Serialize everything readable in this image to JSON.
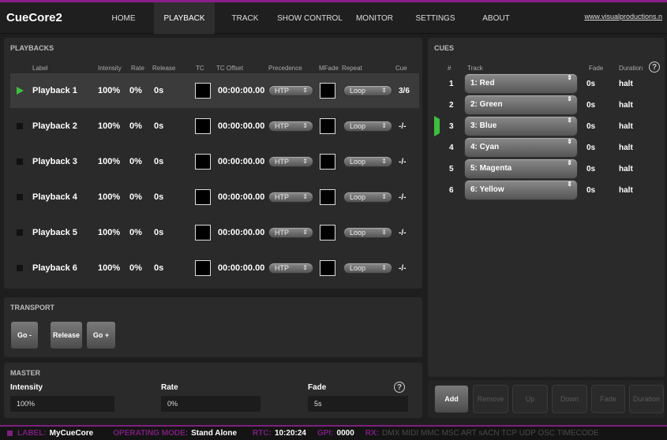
{
  "app": {
    "title": "CueCore2",
    "link": "www.visualproductions.n"
  },
  "nav": {
    "tabs": [
      {
        "label": "HOME"
      },
      {
        "label": "PLAYBACK"
      },
      {
        "label": "TRACK"
      },
      {
        "label": "SHOW CONTROL"
      },
      {
        "label": "MONITOR"
      },
      {
        "label": "SETTINGS"
      },
      {
        "label": "ABOUT"
      }
    ],
    "active": "PLAYBACK"
  },
  "playbacks": {
    "title": "PLAYBACKS",
    "headers": {
      "label": "Label",
      "intensity": "Intensity",
      "rate": "Rate",
      "release": "Release",
      "tc": "TC",
      "tc_offset": "TC Offset",
      "precedence": "Precedence",
      "mfade": "MFade",
      "repeat": "Repeat",
      "cue": "Cue"
    },
    "rows": [
      {
        "label": "Playback 1",
        "intensity": "100%",
        "rate": "0%",
        "release": "0s",
        "tc_offset": "00:00:00.00",
        "precedence": "HTP",
        "repeat": "Loop",
        "cue": "3/6",
        "active": true
      },
      {
        "label": "Playback 2",
        "intensity": "100%",
        "rate": "0%",
        "release": "0s",
        "tc_offset": "00:00:00.00",
        "precedence": "HTP",
        "repeat": "Loop",
        "cue": "-/-",
        "active": false
      },
      {
        "label": "Playback 3",
        "intensity": "100%",
        "rate": "0%",
        "release": "0s",
        "tc_offset": "00:00:00.00",
        "precedence": "HTP",
        "repeat": "Loop",
        "cue": "-/-",
        "active": false
      },
      {
        "label": "Playback 4",
        "intensity": "100%",
        "rate": "0%",
        "release": "0s",
        "tc_offset": "00:00:00.00",
        "precedence": "HTP",
        "repeat": "Loop",
        "cue": "-/-",
        "active": false
      },
      {
        "label": "Playback 5",
        "intensity": "100%",
        "rate": "0%",
        "release": "0s",
        "tc_offset": "00:00:00.00",
        "precedence": "HTP",
        "repeat": "Loop",
        "cue": "-/-",
        "active": false
      },
      {
        "label": "Playback 6",
        "intensity": "100%",
        "rate": "0%",
        "release": "0s",
        "tc_offset": "00:00:00.00",
        "precedence": "HTP",
        "repeat": "Loop",
        "cue": "-/-",
        "active": false
      }
    ]
  },
  "transport": {
    "title": "TRANSPORT",
    "go_minus": "Go -",
    "release": "Release",
    "go_plus": "Go +"
  },
  "master": {
    "title": "MASTER",
    "intensity_label": "Intensity",
    "intensity_value": "100%",
    "rate_label": "Rate",
    "rate_value": "0%",
    "fade_label": "Fade",
    "fade_value": "5s",
    "help": "?"
  },
  "cues": {
    "title": "CUES",
    "headers": {
      "num": "#",
      "track": "Track",
      "fade": "Fade",
      "duration": "Duration",
      "help": "?"
    },
    "rows": [
      {
        "num": "1",
        "track": "1: Red",
        "fade": "0s",
        "duration": "halt",
        "current": false
      },
      {
        "num": "2",
        "track": "2: Green",
        "fade": "0s",
        "duration": "halt",
        "current": false
      },
      {
        "num": "3",
        "track": "3: Blue",
        "fade": "0s",
        "duration": "halt",
        "current": true
      },
      {
        "num": "4",
        "track": "4: Cyan",
        "fade": "0s",
        "duration": "halt",
        "current": false
      },
      {
        "num": "5",
        "track": "5: Magenta",
        "fade": "0s",
        "duration": "halt",
        "current": false
      },
      {
        "num": "6",
        "track": "6: Yellow",
        "fade": "0s",
        "duration": "halt",
        "current": false
      }
    ],
    "buttons": {
      "add": "Add",
      "remove": "Remove",
      "up": "Up",
      "down": "Down",
      "fade": "Fade",
      "duration": "Duration"
    }
  },
  "status": {
    "label_key": "LABEL:",
    "label_value": "MyCueCore",
    "mode_key": "OPERATING MODE:",
    "mode_value": "Stand Alone",
    "rtc_key": "RTC:",
    "rtc_value": "10:20:24",
    "gpi_key": "GPI:",
    "gpi_value": "0000",
    "rx_key": "RX:",
    "rx_value": "DMX MIDI MMC MSC ART sACN TCP UDP OSC TIMECODE"
  },
  "colors": {
    "accent": "#7d1f7d",
    "active_green": "#3fbf3f"
  },
  "icons": {
    "play_indicator": "play-triangle-icon",
    "inactive_indicator": "stop-square-icon",
    "help": "help-circle-icon",
    "dropdown": "chevron-updown-icon"
  }
}
